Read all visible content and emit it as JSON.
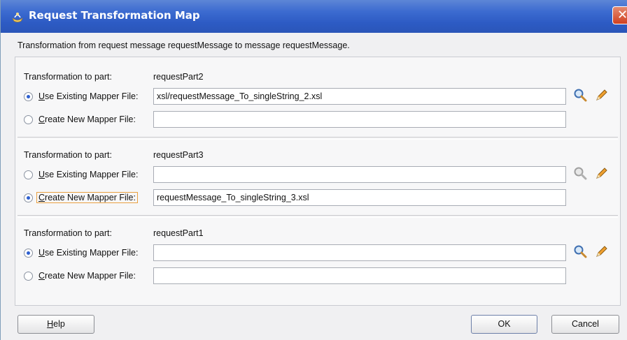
{
  "window": {
    "title": "Request Transformation Map"
  },
  "description": "Transformation from request message requestMessage to message requestMessage.",
  "sections": [
    {
      "part_label": "Transformation to part:",
      "part_name": "requestPart2",
      "use_existing": {
        "mnemonic": "U",
        "label_rest": "se Existing Mapper File:",
        "checked": true,
        "value": "xsl/requestMessage_To_singleString_2.xsl"
      },
      "create_new": {
        "mnemonic": "C",
        "label_rest": "reate New Mapper File:",
        "checked": false,
        "value": ""
      }
    },
    {
      "part_label": "Transformation to part:",
      "part_name": "requestPart3",
      "use_existing": {
        "mnemonic": "U",
        "label_rest": "se Existing Mapper File:",
        "checked": false,
        "value": ""
      },
      "create_new": {
        "mnemonic": "C",
        "label_rest": "reate New Mapper File:",
        "checked": true,
        "value": "requestMessage_To_singleString_3.xsl"
      }
    },
    {
      "part_label": "Transformation to part:",
      "part_name": "requestPart1",
      "use_existing": {
        "mnemonic": "U",
        "label_rest": "se Existing Mapper File:",
        "checked": true,
        "value": ""
      },
      "create_new": {
        "mnemonic": "C",
        "label_rest": "reate New Mapper File:",
        "checked": false,
        "value": ""
      }
    }
  ],
  "icons": {
    "search": "magnifier-icon",
    "edit": "pencil-icon"
  },
  "buttons": {
    "help": {
      "mnemonic": "H",
      "label_rest": "elp"
    },
    "ok": "OK",
    "cancel": "Cancel"
  },
  "colors": {
    "titlebar": "#3c6bd0",
    "accent": "#e8a040"
  }
}
